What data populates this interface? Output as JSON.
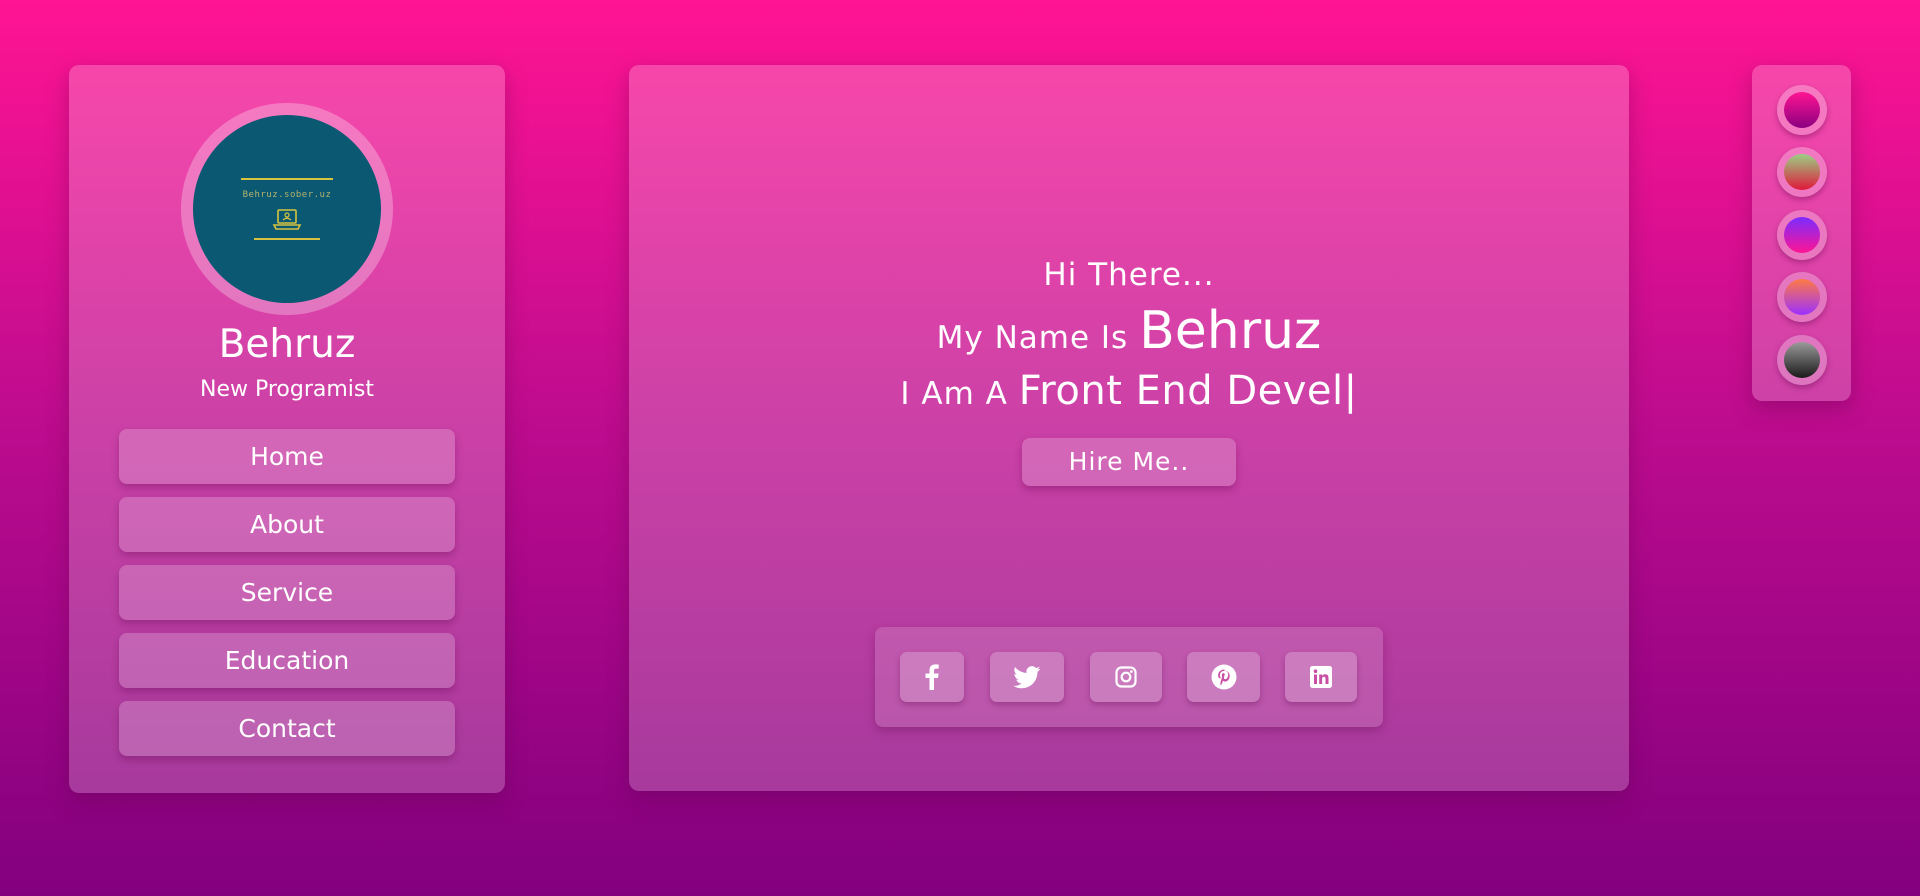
{
  "profile": {
    "name": "Behruz",
    "role": "New Programist",
    "avatar_text": "Behruz.sober.uz",
    "avatar_icon": "laptop-icon"
  },
  "nav": {
    "items": [
      {
        "label": "Home"
      },
      {
        "label": "About"
      },
      {
        "label": "Service"
      },
      {
        "label": "Education"
      },
      {
        "label": "Contact"
      }
    ]
  },
  "hero": {
    "greeting": "Hi There...",
    "name_prefix": "My Name Is",
    "name": "Behruz",
    "role_prefix": "I Am A",
    "role_typed": "Front End Devel|",
    "hire_label": "Hire Me.."
  },
  "socials": [
    {
      "icon": "facebook-icon"
    },
    {
      "icon": "twitter-icon"
    },
    {
      "icon": "instagram-icon"
    },
    {
      "icon": "pinterest-icon"
    },
    {
      "icon": "linkedin-icon"
    }
  ],
  "themes": [
    {
      "name": "pink-theme",
      "from": "#ff1493",
      "to": "#8a0080"
    },
    {
      "name": "green-red-theme",
      "from": "#9ad084",
      "to": "#e0183a"
    },
    {
      "name": "violet-pink-theme",
      "from": "#7a2cff",
      "to": "#ff1493"
    },
    {
      "name": "orange-purple-theme",
      "from": "#ff7a45",
      "to": "#9b30ff"
    },
    {
      "name": "gray-theme",
      "from": "#9a9a9a",
      "to": "#1a1a1a"
    }
  ],
  "colors": {
    "background_top": "#ff1493",
    "background_bottom": "#82007e",
    "avatar_bg": "#0b5872",
    "avatar_accent": "#d7c33f"
  }
}
